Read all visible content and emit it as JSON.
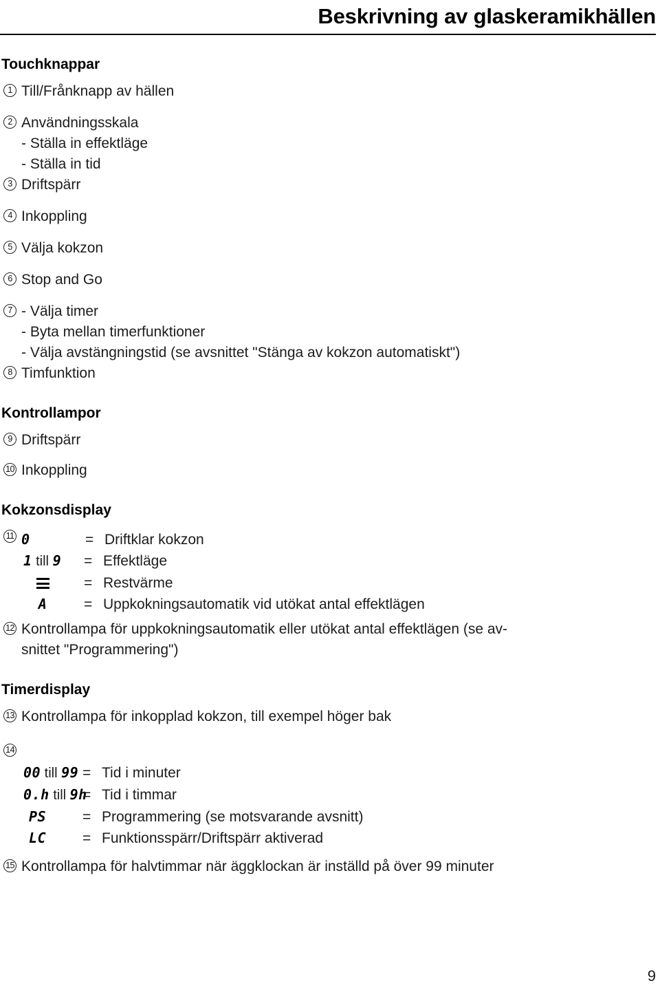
{
  "header": {
    "title": "Beskrivning av glaskeramikhällen"
  },
  "sections": {
    "touch_buttons_heading": "Touchknappar",
    "indicator_lamps_heading": "Kontrollampor",
    "zone_display_heading": "Kokzonsdisplay",
    "timer_display_heading": "Timerdisplay"
  },
  "touch_buttons": {
    "item1": {
      "num": "1",
      "text": "Till/Frånknapp av hällen"
    },
    "item2": {
      "num": "2",
      "text": "Användningsskala",
      "sub1": "- Ställa in effektläge",
      "sub2": "- Ställa in tid"
    },
    "item3": {
      "num": "3",
      "text": "Driftspärr"
    },
    "item4": {
      "num": "4",
      "text": "Inkoppling"
    },
    "item5": {
      "num": "5",
      "text": "Välja kokzon"
    },
    "item6": {
      "num": "6",
      "text": "Stop and Go"
    },
    "item7": {
      "num": "7",
      "text": "- Välja timer",
      "sub1": "- Byta mellan timerfunktioner",
      "sub2": "- Välja avstängningstid (se avsnittet \"Stänga av kokzon automatiskt\")"
    },
    "item8": {
      "num": "8",
      "text": "Timfunktion"
    }
  },
  "indicator_lamps": {
    "item9": {
      "num": "9",
      "text": "Driftspärr"
    },
    "item10": {
      "num": "10",
      "text": "Inkoppling"
    }
  },
  "zone_display": {
    "item11_num": "11",
    "rows": [
      {
        "symbol": "0",
        "eq": "=",
        "desc": "Driftklar kokzon"
      },
      {
        "symbol": "1",
        "till": "till",
        "symbol2": "9",
        "eq": "=",
        "desc": "Effektläge"
      },
      {
        "symbol": "bars-icon",
        "eq": "=",
        "desc": "Restvärme"
      },
      {
        "symbol": "A",
        "eq": "=",
        "desc": "Uppkokningsautomatik vid utökat antal effektlägen"
      }
    ],
    "item12": {
      "num": "12",
      "line1": "Kontrollampa för uppkokningsautomatik eller utökat antal effektlägen (se av-",
      "line2": "snittet \"Programmering\")"
    }
  },
  "timer_display": {
    "item13": {
      "num": "13",
      "text": "Kontrollampa för inkopplad kokzon, till exempel höger bak"
    },
    "item14_num": "14",
    "rows": [
      {
        "symbol": "00",
        "till": "till",
        "symbol2": "99",
        "eq": "=",
        "desc": "Tid i minuter"
      },
      {
        "symbol": "0.h",
        "till": "till",
        "symbol2": "9h",
        "eq": "=",
        "desc": "Tid i timmar"
      },
      {
        "symbol": "PS",
        "eq": "=",
        "desc": "Programmering (se motsvarande avsnitt)"
      },
      {
        "symbol": "LC",
        "eq": "=",
        "desc": "Funktionsspärr/Driftspärr aktiverad"
      }
    ],
    "item15": {
      "num": "15",
      "text": "Kontrollampa för halvtimmar när äggklockan är inställd på över 99 minuter"
    }
  },
  "footer": {
    "page_number": "9"
  }
}
